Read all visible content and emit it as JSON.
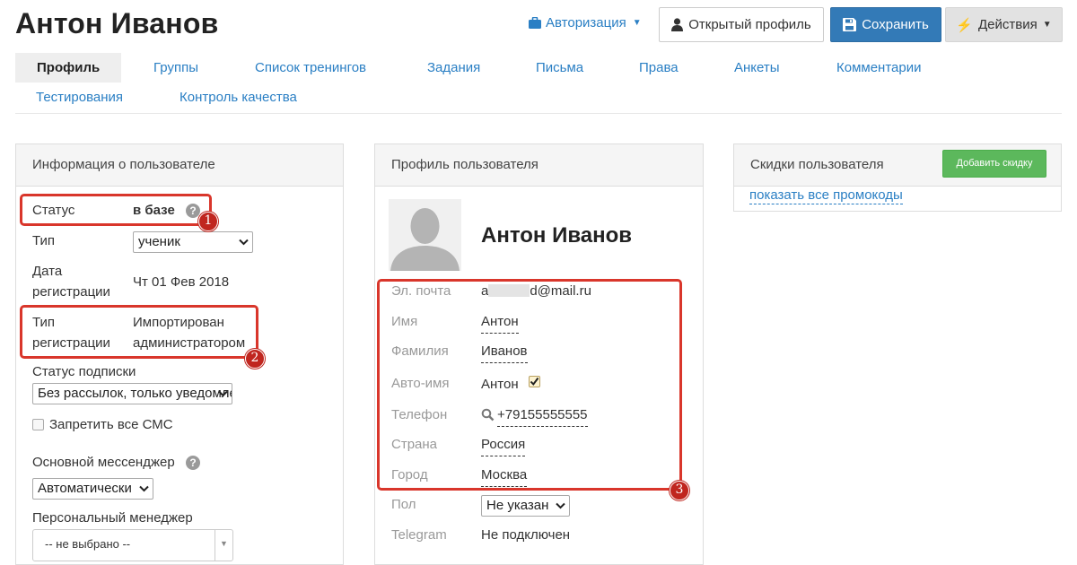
{
  "header": {
    "title": "Антон Иванов",
    "auth_label": "Авторизация",
    "open_profile_label": "Открытый профиль",
    "save_label": "Сохранить",
    "actions_label": "Действия"
  },
  "tabs": [
    {
      "label": "Профиль",
      "active": true
    },
    {
      "label": "Группы"
    },
    {
      "label": "Список тренингов"
    },
    {
      "label": "Задания"
    },
    {
      "label": "Письма"
    },
    {
      "label": "Права"
    },
    {
      "label": "Анкеты"
    },
    {
      "label": "Комментарии"
    },
    {
      "label": "Тестирования"
    },
    {
      "label": "Контроль качества"
    }
  ],
  "user_info": {
    "title": "Информация о пользователе",
    "status_label": "Статус",
    "status_value": "в базе",
    "type_label": "Тип",
    "type_value": "ученик",
    "reg_date_label_1": "Дата",
    "reg_date_label_2": "регистрации",
    "reg_date_value": "Чт 01 Фев 2018",
    "reg_type_label_1": "Тип",
    "reg_type_label_2": "регистрации",
    "reg_type_value_1": "Импортирован",
    "reg_type_value_2": "администратором",
    "subscription_label": "Статус подписки",
    "subscription_value": "Без рассылок, только уведомления",
    "ban_sms_label": "Запретить все СМС",
    "messenger_label": "Основной мессенджер",
    "messenger_value": "Автоматически",
    "manager_label": "Персональный менеджер",
    "manager_value": "-- не выбрано --"
  },
  "profile": {
    "title": "Профиль пользователя",
    "name": "Антон Иванов",
    "email_label": "Эл. почта",
    "email_prefix": "a",
    "email_suffix": "d@mail.ru",
    "first_name_label": "Имя",
    "first_name": "Антон",
    "last_name_label": "Фамилия",
    "last_name": "Иванов",
    "auto_name_label": "Авто-имя",
    "auto_name": "Антон",
    "auto_name_checked": true,
    "phone_label": "Телефон",
    "phone": "+79155555555",
    "country_label": "Страна",
    "country": "Россия",
    "city_label": "Город",
    "city": "Москва",
    "gender_label": "Пол",
    "gender_value": "Не указан",
    "telegram_label": "Telegram",
    "telegram_value": "Не подключен"
  },
  "discounts": {
    "title": "Скидки пользователя",
    "add_button": "Добавить скидку",
    "show_promos": "показать все промокоды"
  },
  "annotations": [
    "1",
    "2",
    "3"
  ],
  "colors": {
    "accent": "#2a7fc4",
    "primary_button": "#337ab7",
    "success_button": "#5cb85c",
    "annotation_red": "#d9362b"
  }
}
